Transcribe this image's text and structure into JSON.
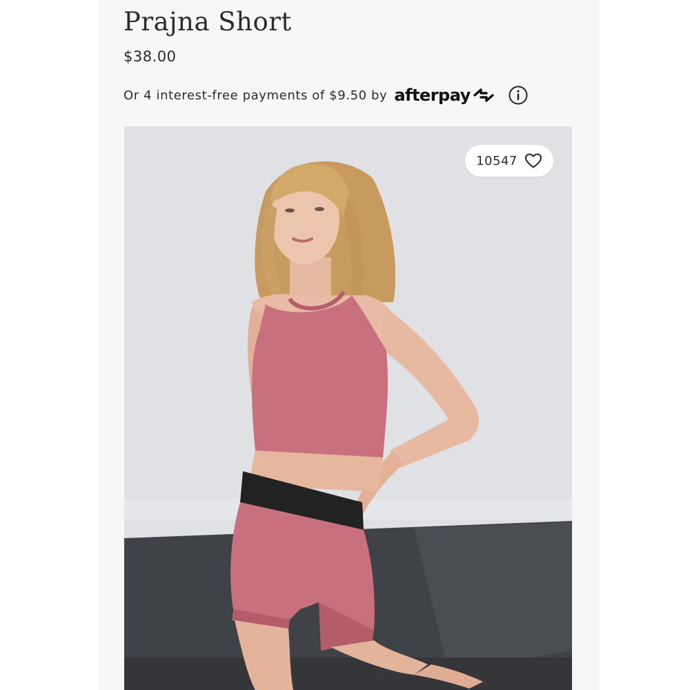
{
  "product": {
    "title": "Prajna Short",
    "price": "$38.00"
  },
  "afterpay": {
    "text": "Or 4 interest-free payments of $9.50 by",
    "brand": "afterpay",
    "logo_icon": "afterpay-arrows-icon",
    "info_icon": "info-icon"
  },
  "image": {
    "subject": "model-in-pink-ribbed-crop-top-and-bike-shorts",
    "like_count": "10547",
    "like_icon": "heart-icon"
  },
  "colors": {
    "page_background": "#f9f7f6",
    "text": "#2b2b2b",
    "garment_pink": "#c9707e",
    "waistband": "#222222",
    "wall": "#dfe1e4",
    "floor": "#3f4246"
  }
}
